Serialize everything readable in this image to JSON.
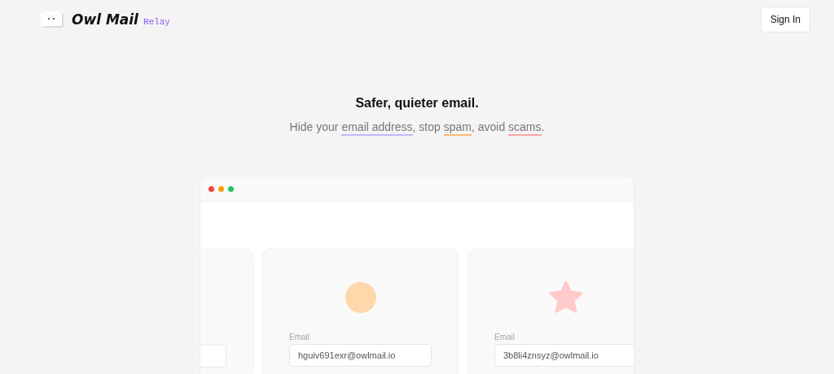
{
  "brand": {
    "name": "Owl Mail",
    "tag": "Relay"
  },
  "nav": {
    "sign_in": "Sign In"
  },
  "hero": {
    "title": "Safer, quieter email.",
    "subtitle": [
      {
        "text": "Hide your "
      },
      {
        "text": "email address",
        "color": "#c4b5fd"
      },
      {
        "text": ", stop "
      },
      {
        "text": "spam",
        "color": "#fdba74"
      },
      {
        "text": ", avoid "
      },
      {
        "text": "scams",
        "color": "#fca5a5"
      },
      {
        "text": "."
      }
    ]
  },
  "mock_window": {
    "dots": [
      {
        "color": "#ef4444"
      },
      {
        "color": "#f59e0b"
      },
      {
        "color": "#22c55e"
      }
    ],
    "cards": [
      {
        "kind": "blank"
      },
      {
        "kind": "circle",
        "label": "Email",
        "value": "hguiv691exr@owlmail.io"
      },
      {
        "kind": "star",
        "label": "Email",
        "value": "3b8li4znsyz@owlmail.io"
      }
    ]
  }
}
